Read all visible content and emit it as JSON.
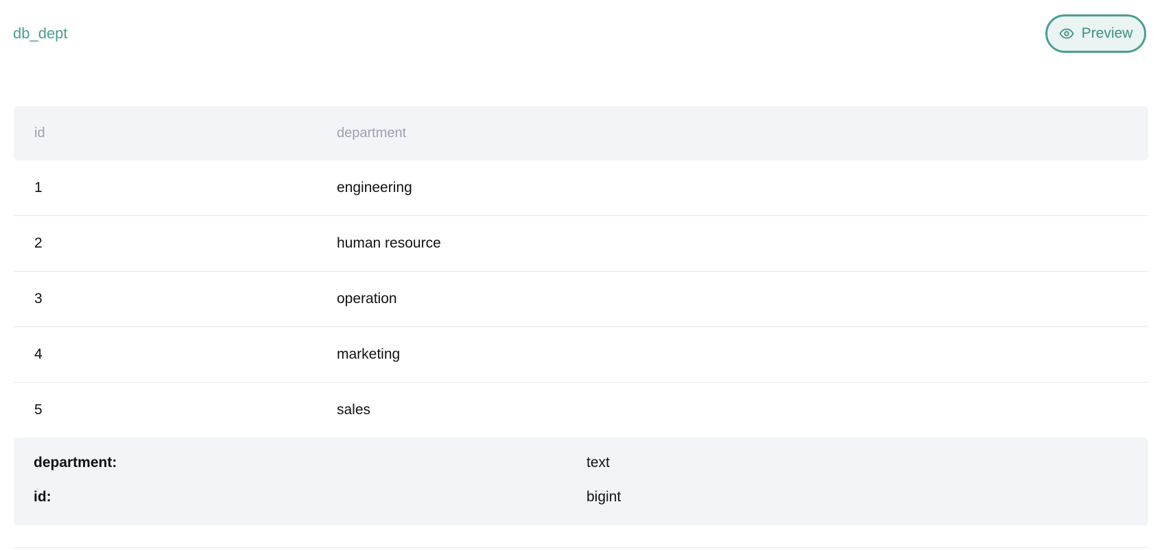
{
  "header": {
    "table_name": "db_dept",
    "preview_label": "Preview",
    "preview_icon": "eye-icon"
  },
  "table": {
    "columns": [
      "id",
      "department"
    ],
    "rows": [
      {
        "id": "1",
        "department": "engineering"
      },
      {
        "id": "2",
        "department": "human resource"
      },
      {
        "id": "3",
        "department": "operation"
      },
      {
        "id": "4",
        "department": "marketing"
      },
      {
        "id": "5",
        "department": "sales"
      }
    ]
  },
  "schema": [
    {
      "key": "department:",
      "type": "text"
    },
    {
      "key": "id:",
      "type": "bigint"
    }
  ],
  "colors": {
    "accent": "#4a9e93",
    "header_bg": "#f2f4f8",
    "header_text": "#9aa1ad"
  }
}
